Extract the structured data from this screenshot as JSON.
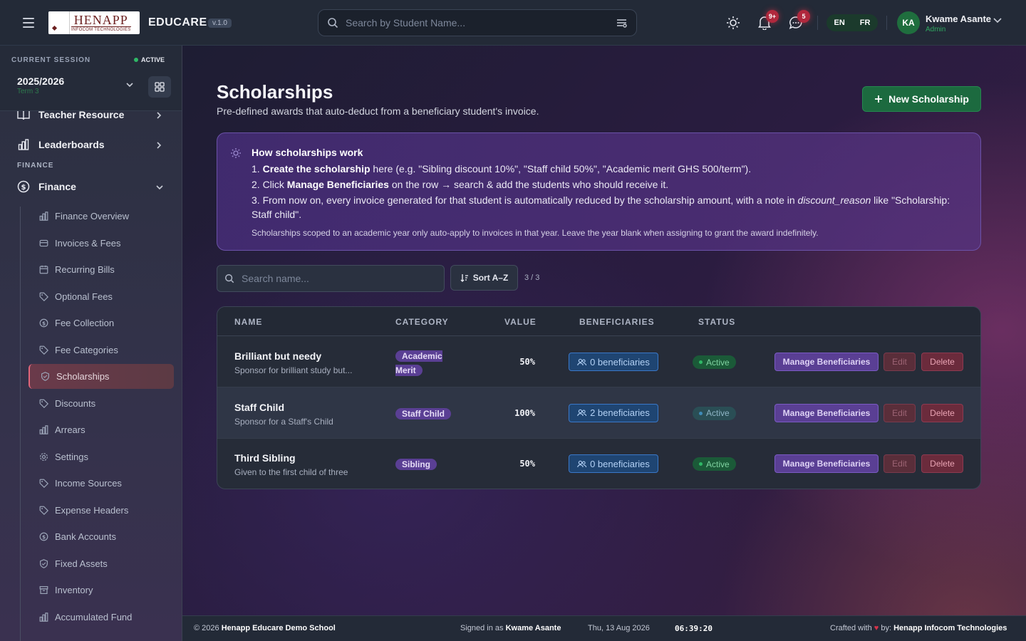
{
  "header": {
    "logo_text": "HENAPP",
    "logo_subtext": "INFOCOM TECHNOLOGIES",
    "brand": "EDUCARE",
    "version": "v.1.0",
    "search_placeholder": "Search by Student Name...",
    "notifications_badge": "9+",
    "messages_badge": "5",
    "languages": [
      "EN",
      "FR"
    ],
    "user_initials": "KA",
    "user_name": "Kwame Asante",
    "user_role": "Admin"
  },
  "sidebar": {
    "session_label": "CURRENT SESSION",
    "session_status": "ACTIVE",
    "session_year": "2025/2026",
    "session_term": "Term 3",
    "items": [
      {
        "label": "Teacher Resource",
        "icon": "book-icon"
      },
      {
        "label": "Leaderboards",
        "icon": "bar-chart-icon"
      }
    ],
    "section_finance": "FINANCE",
    "finance_label": "Finance",
    "finance_sub": [
      {
        "label": "Finance Overview",
        "icon": "bar-chart-icon"
      },
      {
        "label": "Invoices & Fees",
        "icon": "invoice-icon"
      },
      {
        "label": "Recurring Bills",
        "icon": "calendar-icon"
      },
      {
        "label": "Optional Fees",
        "icon": "tag-icon"
      },
      {
        "label": "Fee Collection",
        "icon": "coin-icon"
      },
      {
        "label": "Fee Categories",
        "icon": "tag-icon"
      },
      {
        "label": "Scholarships",
        "icon": "shield-icon"
      },
      {
        "label": "Discounts",
        "icon": "tag-icon"
      },
      {
        "label": "Arrears",
        "icon": "bar-chart-icon"
      },
      {
        "label": "Settings",
        "icon": "gear-icon"
      },
      {
        "label": "Income Sources",
        "icon": "tag-icon"
      },
      {
        "label": "Expense Headers",
        "icon": "tag-icon"
      },
      {
        "label": "Bank Accounts",
        "icon": "coin-icon"
      },
      {
        "label": "Fixed Assets",
        "icon": "shield-icon"
      },
      {
        "label": "Inventory",
        "icon": "box-icon"
      },
      {
        "label": "Accumulated Fund",
        "icon": "bar-chart-icon"
      }
    ]
  },
  "main": {
    "title": "Scholarships",
    "subtitle": "Pre-defined awards that auto-deduct from a beneficiary student's invoice.",
    "new_button": "New Scholarship",
    "info": {
      "heading": "How scholarships work",
      "step1_prefix": "1. ",
      "step1_bold": "Create the scholarship",
      "step1_rest": " here (e.g. \"Sibling discount 10%\", \"Staff child 50%\", \"Academic merit GHS 500/term\").",
      "step2_prefix": "2. Click ",
      "step2_bold": "Manage Beneficiaries",
      "step2_rest": " on the row → search & add the students who should receive it.",
      "step3_a": "3. From now on, every invoice generated for that student is automatically reduced by the scholarship amount, with a note in ",
      "step3_em": "discount_reason",
      "step3_b": " like \"Scholarship: Staff child\".",
      "note": "Scholarships scoped to an academic year only auto-apply to invoices in that year. Leave the year blank when assigning to grant the award indefinitely."
    },
    "search_placeholder": "Search name...",
    "sort_label": "Sort A–Z",
    "count": "3 / 3",
    "columns": [
      "NAME",
      "CATEGORY",
      "VALUE",
      "BENEFICIARIES",
      "STATUS"
    ],
    "rows": [
      {
        "name": "Brilliant but needy",
        "desc": "Sponsor for brilliant study but...",
        "category": "Academic Merit",
        "value": "50%",
        "beneficiaries": "0 beneficiaries",
        "status": "Active"
      },
      {
        "name": "Staff Child",
        "desc": "Sponsor for a Staff's Child",
        "category": "Staff Child",
        "value": "100%",
        "beneficiaries": "2 beneficiaries",
        "status": "Active"
      },
      {
        "name": "Third Sibling",
        "desc": "Given to the first child of three",
        "category": "Sibling",
        "value": "50%",
        "beneficiaries": "0 beneficiaries",
        "status": "Active"
      }
    ],
    "action_manage": "Manage Beneficiaries",
    "action_edit": "Edit",
    "action_delete": "Delete"
  },
  "footer": {
    "copyright_prefix": "© 2026 ",
    "school": "Henapp Educare Demo School",
    "signed_prefix": "Signed in as ",
    "signed_user": "Kwame Asante",
    "date": "Thu, 13 Aug 2026",
    "time": "06:39:20",
    "crafted_prefix": "Crafted with ",
    "heart": "♥",
    "crafted_by": " by: ",
    "company": "Henapp Infocom Technologies"
  },
  "colors": {
    "accent_green": "#1c6a3f",
    "purple_chip": "#5a3f94",
    "blue_chip": "#1f4572",
    "danger": "#6b2b3c"
  }
}
